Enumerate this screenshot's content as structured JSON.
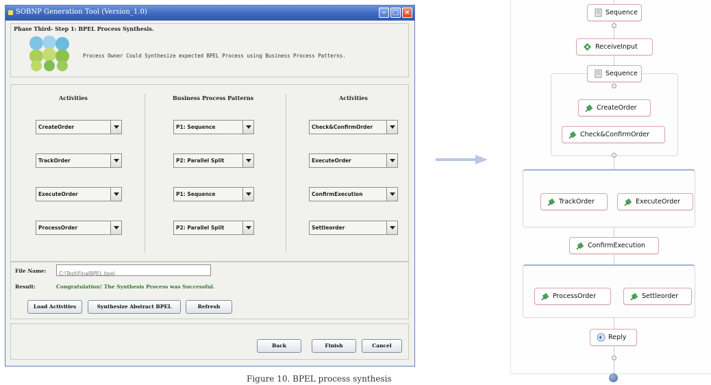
{
  "window": {
    "title": "SOBNP Generation Tool (Version_1.0)",
    "phase_title": "Phase Third- Step 1: BPEL Process Synthesis.",
    "phase_description": "Process Owner Could Synthesize expected BPEL Process using Business Process Patterns.",
    "columns": {
      "left_header": "Activities",
      "middle_header": "Business Process Patterns",
      "right_header": "Activities"
    },
    "rows": [
      {
        "left": "CreateOrder",
        "pattern": "P1: Sequence",
        "right": "Check&ConfirmOrder"
      },
      {
        "left": "TrackOrder",
        "pattern": "P2: Parallel Split",
        "right": "ExecuteOrder"
      },
      {
        "left": "ExecuteOrder",
        "pattern": "P1: Sequence",
        "right": "ConfirmExecution"
      },
      {
        "left": "ProcessOrder",
        "pattern": "P2: Parallel Split",
        "right": "Settleorder"
      }
    ],
    "file_name_label": "File Name:",
    "file_name_value": "C:\\Test\\FinalBPEL.bpel",
    "result_label": "Result:",
    "result_text": "Congratulation! The Synthesis Process was Successful.",
    "buttons": {
      "load": "Load Activities",
      "synthesize": "Synthesize Abstract BPEL",
      "refresh": "Refresh",
      "back": "Back",
      "finish": "Finish",
      "cancel": "Cancel"
    }
  },
  "caption": "Figure 10. BPEL process synthesis",
  "diagram": {
    "nodes": {
      "sequence_outer": "Sequence",
      "receive_input": "ReceiveInput",
      "sequence_inner": "Sequence",
      "create_order": "CreateOrder",
      "check_confirm": "Check&ConfirmOrder",
      "track_order": "TrackOrder",
      "execute_order": "ExecuteOrder",
      "confirm_execution": "ConfirmExecution",
      "process_order": "ProcessOrder",
      "settle_order": "Settleorder",
      "reply": "Reply"
    }
  },
  "colors": {
    "title_bar": "#3f68c0",
    "result_green": "#2f7a2f",
    "node_border": "#d9a6a6",
    "group_accent": "#9bb3dc",
    "arrow": "#b9c6e4"
  },
  "icons": {
    "window": "app-icon",
    "invoke": "invoke-icon",
    "receive": "receive-icon",
    "reply": "reply-icon",
    "sequence": "sequence-icon",
    "dropdown": "chevron-down-icon"
  }
}
